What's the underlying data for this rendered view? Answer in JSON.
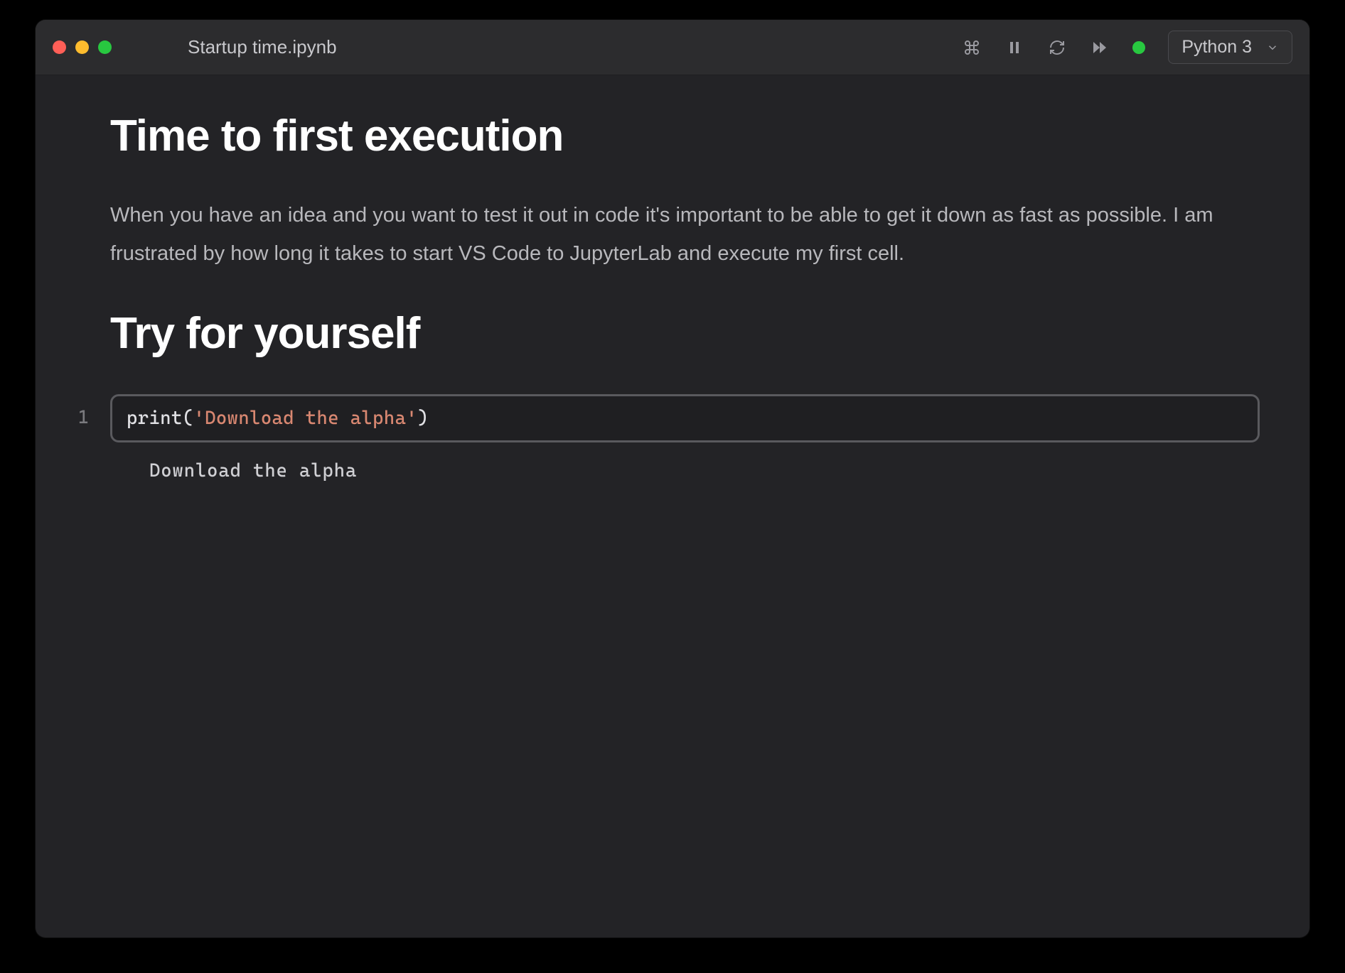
{
  "titlebar": {
    "filename": "Startup time.ipynb"
  },
  "toolbar": {
    "kernel_label": "Python 3"
  },
  "notebook": {
    "heading1": "Time to first execution",
    "paragraph": "When you have an idea and you want to test it out in code it's important to be able to get it down as fast as possible. I am frustrated by how long it takes to start VS Code to JupyterLab and execute my first cell.",
    "heading2": "Try for yourself",
    "cell": {
      "number": "1",
      "code_fn": "print",
      "code_paren_open": "(",
      "code_string": "'Download the alpha'",
      "code_paren_close": ")",
      "output": "Download the alpha"
    }
  }
}
